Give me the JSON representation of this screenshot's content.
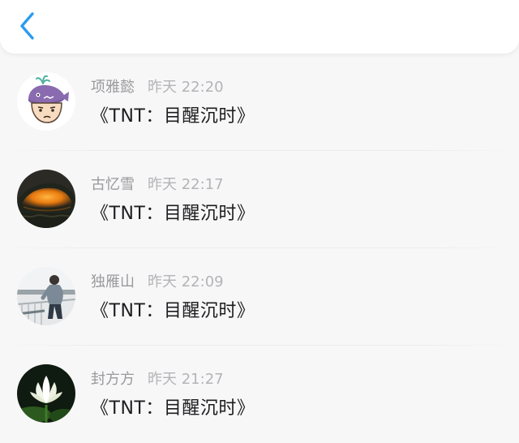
{
  "header": {
    "back_icon": "chevron-left-icon",
    "accent_color": "#2d9bf0"
  },
  "comments": [
    {
      "username": "项雅懿",
      "time": "昨天 22:20",
      "text": "《TNT：目醒沉时》",
      "avatar_icon": "cartoon-whale-hat-avatar"
    },
    {
      "username": "古忆雪",
      "time": "昨天 22:17",
      "text": "《TNT：目醒沉时》",
      "avatar_icon": "orange-boat-sunset-avatar"
    },
    {
      "username": "独雁山",
      "time": "昨天 22:09",
      "text": "《TNT：目醒沉时》",
      "avatar_icon": "person-by-railing-avatar"
    },
    {
      "username": "封方方",
      "time": "昨天 21:27",
      "text": "《TNT：目醒沉时》",
      "avatar_icon": "white-lotus-flower-avatar"
    }
  ]
}
